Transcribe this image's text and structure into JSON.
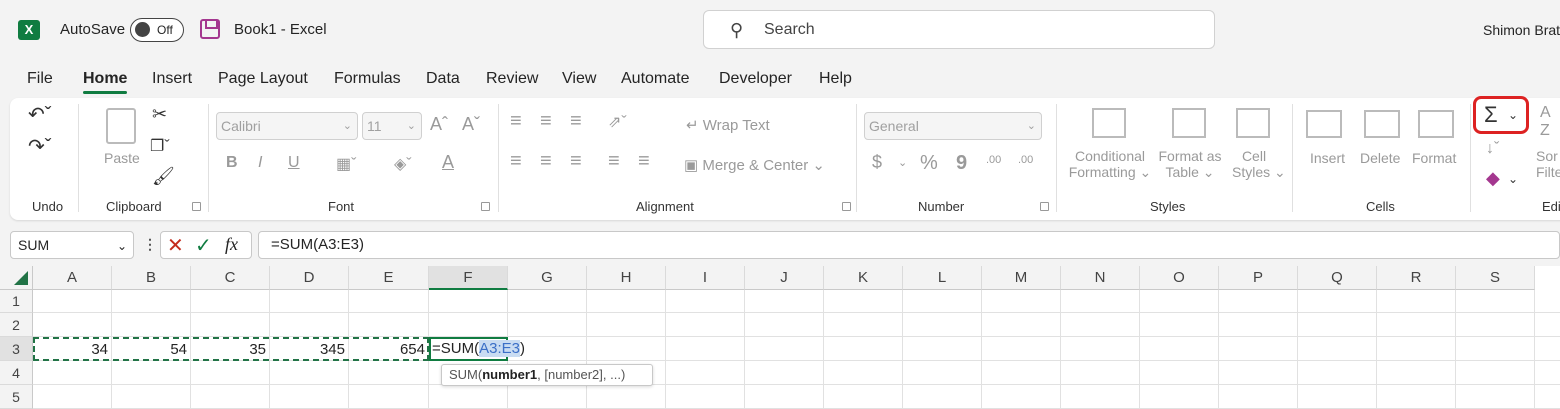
{
  "titlebar": {
    "app_badge": "X",
    "autosave_label": "AutoSave",
    "autosave_state": "Off",
    "doc_title": "Book1  -  Excel",
    "search_placeholder": "Search",
    "user_name": "Shimon Brat"
  },
  "menu": [
    "File",
    "Home",
    "Insert",
    "Page Layout",
    "Formulas",
    "Data",
    "Review",
    "View",
    "Automate",
    "Developer",
    "Help"
  ],
  "ribbon": {
    "undo": {
      "label": "Undo"
    },
    "clipboard": {
      "label": "Clipboard",
      "paste": "Paste"
    },
    "font": {
      "label": "Font",
      "name": "Calibri",
      "size": "11",
      "bold": "B",
      "italic": "I",
      "underline": "U",
      "grow": "Aˆ",
      "shrink": "Aˇ",
      "font_color": "A"
    },
    "alignment": {
      "label": "Alignment",
      "wrap": "Wrap Text",
      "merge": "Merge & Center"
    },
    "number": {
      "label": "Number",
      "format": "General",
      "currency": "$",
      "percent": "%",
      "comma": "9",
      "inc_decimal": ".00",
      "dec_decimal": ".00"
    },
    "styles": {
      "label": "Styles",
      "conditional_1": "Conditional",
      "conditional_2": "Formatting",
      "format_table_1": "Format as",
      "format_table_2": "Table",
      "cell_styles_1": "Cell",
      "cell_styles_2": "Styles"
    },
    "cells": {
      "label": "Cells",
      "insert": "Insert",
      "delete": "Delete",
      "format": "Format"
    },
    "editing": {
      "label": "Edi",
      "sort_1": "Sor",
      "sort_2": "Filte"
    }
  },
  "formula_bar": {
    "name_box": "SUM",
    "fx": "fx",
    "formula": "=SUM(A3:E3)"
  },
  "grid": {
    "columns": [
      "A",
      "B",
      "C",
      "D",
      "E",
      "F",
      "G",
      "H",
      "I",
      "J",
      "K",
      "L",
      "M",
      "N",
      "O",
      "P",
      "Q",
      "R",
      "S"
    ],
    "rows": [
      "1",
      "2",
      "3",
      "4",
      "5"
    ],
    "row3": [
      "34",
      "54",
      "35",
      "345",
      "654"
    ],
    "edit_prefix": "=SUM(",
    "edit_ref": "A3:E3",
    "edit_suffix": ")",
    "tooltip_fn": "SUM(",
    "tooltip_arg1": "number1",
    "tooltip_rest": ", [number2], ...)"
  },
  "colors": {
    "excel_green": "#107c41",
    "highlight_red": "#dd2222"
  }
}
